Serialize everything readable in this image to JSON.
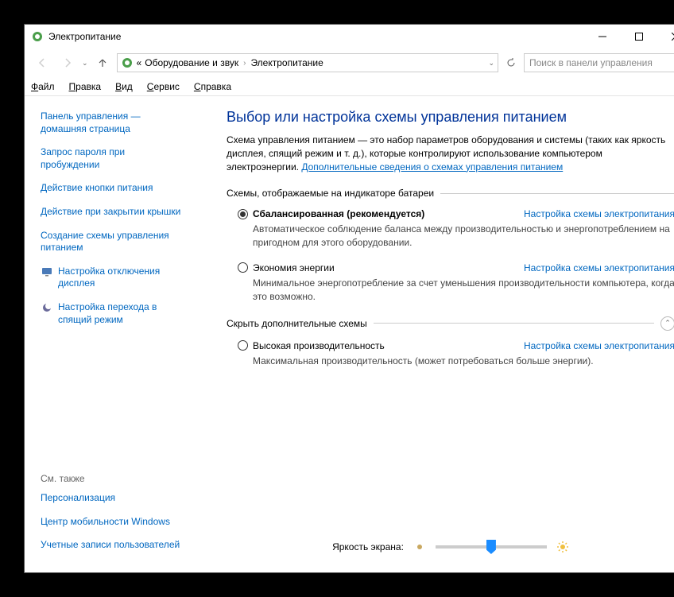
{
  "window": {
    "title": "Электропитание"
  },
  "breadcrumb": {
    "item1": "Оборудование и звук",
    "item2": "Электропитание"
  },
  "search": {
    "placeholder": "Поиск в панели управления"
  },
  "menu": {
    "file": "Файл",
    "edit": "Правка",
    "view": "Вид",
    "tools": "Сервис",
    "help": "Справка"
  },
  "help_icon": "?",
  "sidebar": {
    "links": {
      "home": "Панель управления — домашняя страница",
      "password": "Запрос пароля при пробуждении",
      "powerbtn": "Действие кнопки питания",
      "lid": "Действие при закрытии крышки",
      "create": "Создание схемы управления питанием",
      "display": "Настройка отключения дисплея",
      "sleep": "Настройка перехода в спящий режим"
    },
    "seealso": {
      "heading": "См. также",
      "a": "Персонализация",
      "b": "Центр мобильности Windows",
      "c": "Учетные записи пользователей"
    }
  },
  "main": {
    "title": "Выбор или настройка схемы управления питанием",
    "desc_pre": "Схема управления питанием — это набор параметров оборудования и системы (таких как яркость дисплея, спящий режим и т. д.), которые контролируют использование компьютером электроэнергии. ",
    "desc_link": "Дополнительные сведения о схемах управления питанием",
    "group1": "Схемы, отображаемые на индикаторе батареи",
    "plan_link": "Настройка схемы электропитания",
    "balanced": {
      "name": "Сбалансированная (рекомендуется)",
      "desc": "Автоматическое соблюдение баланса между производительностью и энергопотреблением на пригодном для этого оборудовании."
    },
    "saver": {
      "name": "Экономия энергии",
      "desc": "Минимальное энергопотребление за счет уменьшения производительности компьютера, когда это возможно."
    },
    "group2": "Скрыть дополнительные схемы",
    "high": {
      "name": "Высокая производительность",
      "desc": "Максимальная производительность (может потребоваться больше энергии)."
    },
    "brightness_label": "Яркость экрана:"
  }
}
